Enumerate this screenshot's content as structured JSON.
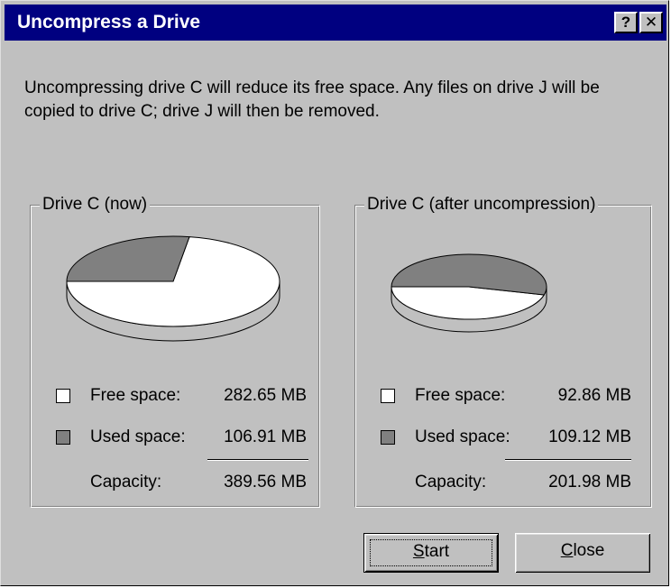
{
  "window": {
    "title": "Uncompress a Drive",
    "help_glyph": "?",
    "close_glyph": "✕"
  },
  "description": "Uncompressing drive C will reduce its free space. Any files on drive J will be copied to drive C; drive J will then be removed.",
  "drives": [
    {
      "title": "Drive C (now)",
      "free_label": "Free space:",
      "free_value": "282.65 MB",
      "used_label": "Used space:",
      "used_value": "106.91 MB",
      "capacity_label": "Capacity:",
      "capacity_value": "389.56 MB",
      "used_fraction": 0.2744
    },
    {
      "title": "Drive C (after uncompression)",
      "free_label": "Free space:",
      "free_value": "92.86 MB",
      "used_label": "Used space:",
      "used_value": "109.12 MB",
      "capacity_label": "Capacity:",
      "capacity_value": "201.98 MB",
      "used_fraction": 0.5403
    }
  ],
  "buttons": {
    "start_first": "S",
    "start_rest": "tart",
    "close_first": "C",
    "close_rest": "lose"
  },
  "colors": {
    "window_bg": "#c0c0c0",
    "titlebar_bg": "#000080",
    "free_color": "#ffffff",
    "used_color": "#808080"
  }
}
